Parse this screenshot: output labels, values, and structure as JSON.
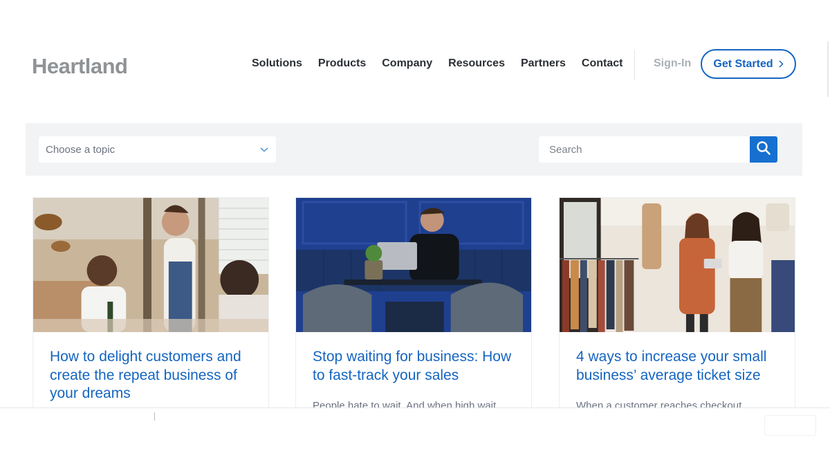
{
  "brand": {
    "logo_text": "Heartland",
    "accent_color": "#1565c0"
  },
  "nav": {
    "items": [
      {
        "label": "Solutions"
      },
      {
        "label": "Products"
      },
      {
        "label": "Company"
      },
      {
        "label": "Resources"
      },
      {
        "label": "Partners"
      },
      {
        "label": "Contact"
      }
    ],
    "sign_in": "Sign-In",
    "get_started": "Get Started",
    "get_started_icon": "chevron-right-icon"
  },
  "filters": {
    "topic_placeholder": "Choose a topic",
    "topic_icon": "chevron-down-icon",
    "search_placeholder": "Search",
    "search_icon": "search-icon"
  },
  "cards": [
    {
      "title": "How to delight customers and create the repeat business of your dreams",
      "excerpt": "",
      "image": "restaurant-waitress-serving-diners"
    },
    {
      "title": "Stop waiting for business: How to fast-track your sales",
      "excerpt": "People hate to wait. And when high wait",
      "image": "man-with-laptop-in-blue-booth"
    },
    {
      "title": "4 ways to increase your small business’ average ticket size",
      "excerpt": "When a customer reaches checkout",
      "image": "women-shopping-clothing-boutique"
    }
  ]
}
